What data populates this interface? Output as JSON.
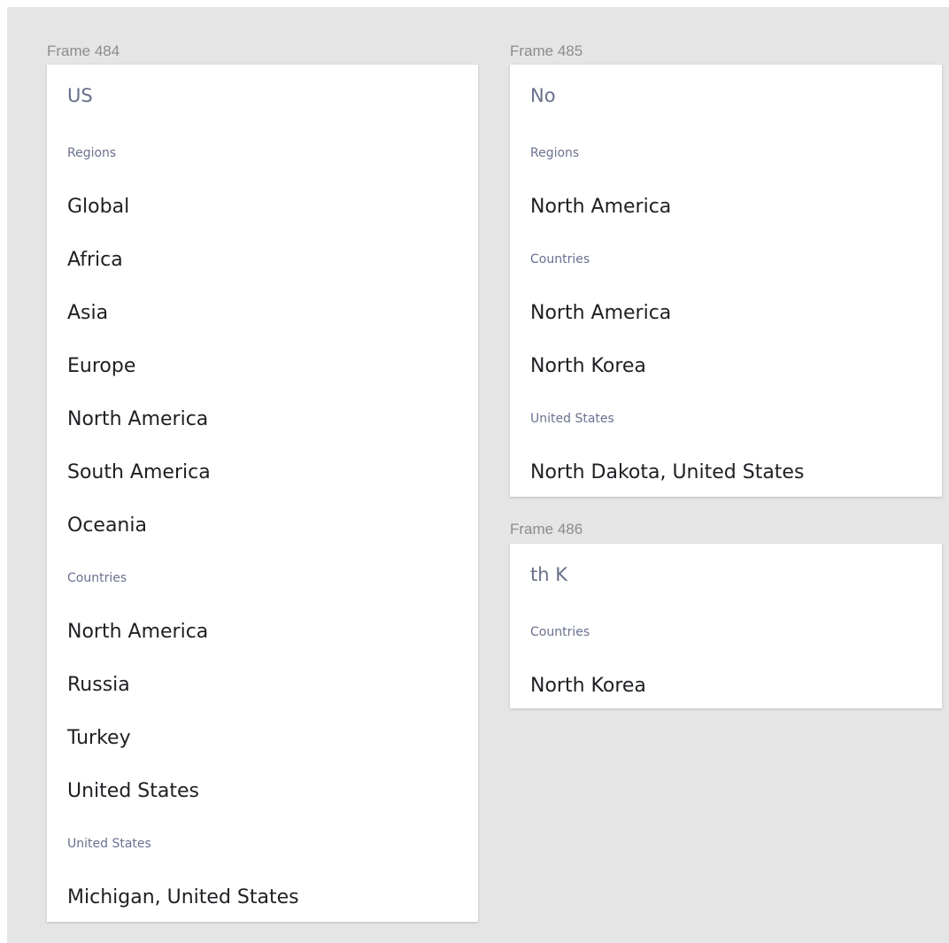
{
  "frames": [
    {
      "label": "Frame 484",
      "query": "US",
      "groups": [
        {
          "header": "Regions",
          "items": [
            "Global",
            "Africa",
            "Asia",
            "Europe",
            "North America",
            "South America",
            "Oceania"
          ]
        },
        {
          "header": "Countries",
          "items": [
            "North America",
            "Russia",
            "Turkey",
            "United States"
          ]
        },
        {
          "header": "United States",
          "items": [
            "Michigan, United States"
          ]
        }
      ]
    },
    {
      "label": "Frame 485",
      "query": "No",
      "groups": [
        {
          "header": "Regions",
          "items": [
            "North America"
          ]
        },
        {
          "header": "Countries",
          "items": [
            "North America",
            "North Korea"
          ]
        },
        {
          "header": "United States",
          "items": [
            "North Dakota, United States"
          ]
        }
      ]
    },
    {
      "label": "Frame 486",
      "query": "th K",
      "groups": [
        {
          "header": "Countries",
          "items": [
            "North Korea"
          ]
        }
      ]
    }
  ]
}
